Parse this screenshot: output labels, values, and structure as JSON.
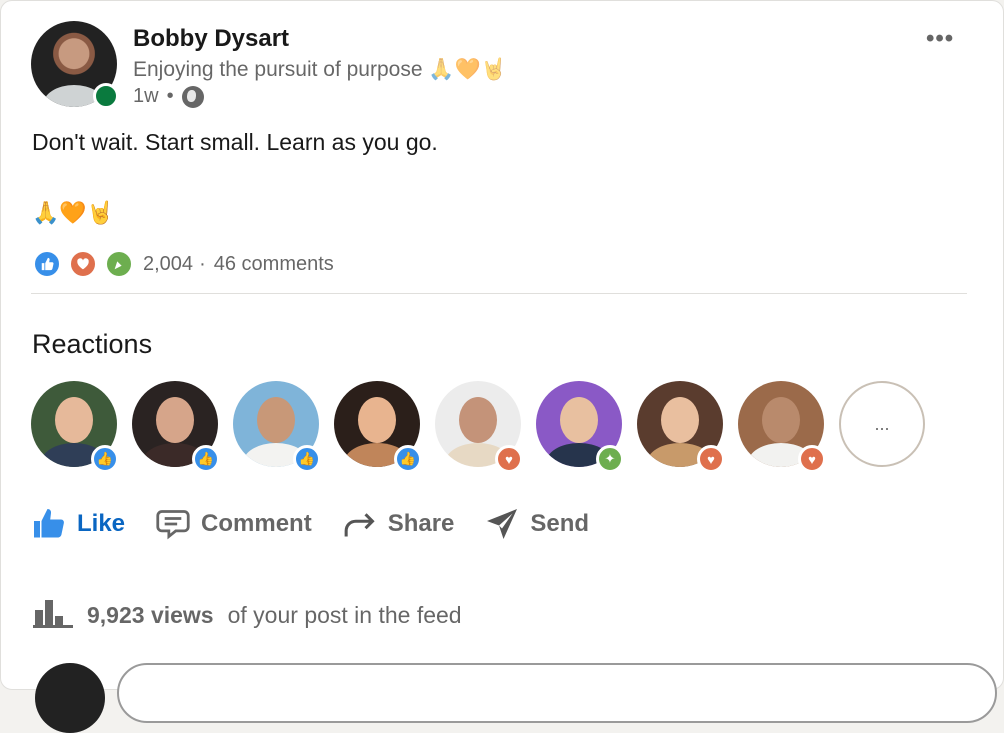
{
  "post": {
    "author_name": "Bobby Dysart",
    "author_headline": "Enjoying the pursuit of purpose 🙏🧡🤘",
    "time_ago": "1w",
    "separator": "•",
    "more_label": "•••",
    "body_text": "Don't wait. Start small. Learn as you go.",
    "emoji_line": "🙏🧡🤘"
  },
  "summary": {
    "reaction_count": "2,004",
    "dot": "·",
    "comments": "46 comments",
    "icons": [
      "like-icon",
      "love-icon",
      "celebrate-icon"
    ]
  },
  "reactions": {
    "title": "Reactions",
    "more_label": "...",
    "people": [
      {
        "reaction": "like"
      },
      {
        "reaction": "like"
      },
      {
        "reaction": "like"
      },
      {
        "reaction": "like"
      },
      {
        "reaction": "love"
      },
      {
        "reaction": "celebrate"
      },
      {
        "reaction": "love"
      },
      {
        "reaction": "love"
      }
    ]
  },
  "actions": {
    "like": "Like",
    "comment": "Comment",
    "share": "Share",
    "send": "Send"
  },
  "views": {
    "count": "9,923 views",
    "suffix": "of your post in the feed"
  },
  "colors": {
    "like_blue": "#0a66c2",
    "love_orange": "#df704d",
    "celebrate_green": "#6dae4f",
    "presence_green": "#0a7a3e"
  }
}
